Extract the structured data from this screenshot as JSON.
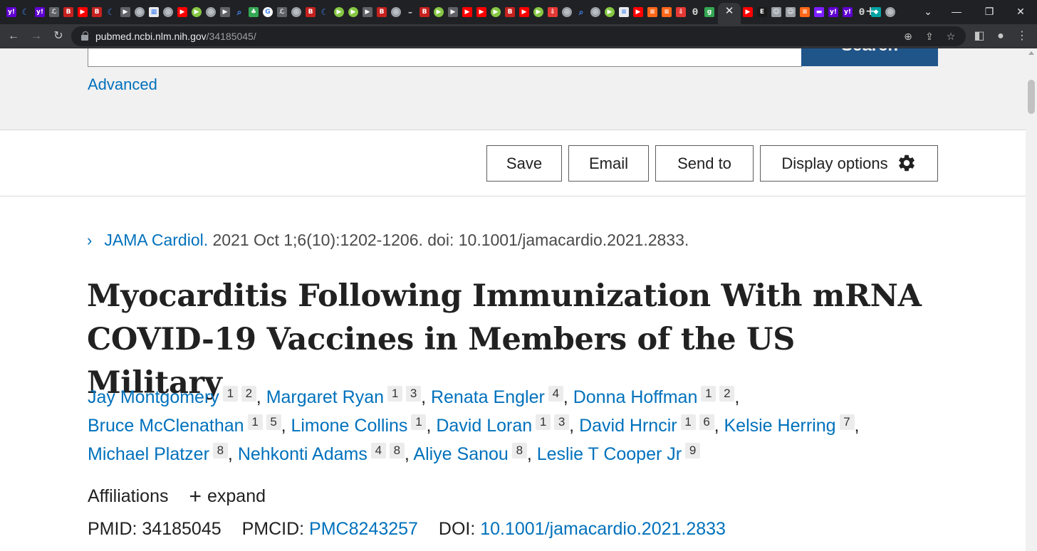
{
  "browser": {
    "favicons": [
      {
        "icon": "yahoo-icon",
        "bg": "#6001d2",
        "t": "y!"
      },
      {
        "icon": "crescent-icon",
        "bg": "#4285f4",
        "t": "☾",
        "shape": "n"
      },
      {
        "icon": "yahoo-icon",
        "bg": "#6001d2",
        "t": "y!"
      },
      {
        "icon": "text-icon",
        "bg": "#5f6368",
        "t": "ℒ"
      },
      {
        "icon": "bi-icon",
        "bg": "#c5221f",
        "t": "B"
      },
      {
        "icon": "youtube-icon",
        "bg": "#ff0000",
        "t": "▶"
      },
      {
        "icon": "bi-icon",
        "bg": "#c5221f",
        "t": "B"
      },
      {
        "icon": "crescent-icon",
        "bg": "#4285f4",
        "t": "☾",
        "shape": "n"
      },
      {
        "icon": "play-icon",
        "bg": "#5f6368",
        "t": "▶"
      },
      {
        "icon": "globe-icon",
        "bg": "#9aa0a6",
        "t": "◎",
        "shape": "c"
      },
      {
        "icon": "image-icon",
        "bg": "#e8eaed",
        "t": "▦"
      },
      {
        "icon": "globe-icon",
        "bg": "#9aa0a6",
        "t": "◎",
        "shape": "c"
      },
      {
        "icon": "youtube-icon",
        "bg": "#ff0000",
        "t": "▶"
      },
      {
        "icon": "rumble-icon",
        "bg": "#85c742",
        "t": "▶",
        "shape": "c"
      },
      {
        "icon": "globe-icon",
        "bg": "#9aa0a6",
        "t": "◎",
        "shape": "c"
      },
      {
        "icon": "play-icon",
        "bg": "#5f6368",
        "t": "▶"
      },
      {
        "icon": "search-icon",
        "bg": "#4285f4",
        "t": "⌕",
        "shape": "n"
      },
      {
        "icon": "tree-icon",
        "bg": "#34a853",
        "t": "♣"
      },
      {
        "icon": "google-icon",
        "bg": "#ffffff",
        "t": "G",
        "shape": "c"
      },
      {
        "icon": "text-icon",
        "bg": "#5f6368",
        "t": "ℒ"
      },
      {
        "icon": "globe-icon",
        "bg": "#9aa0a6",
        "t": "◎",
        "shape": "c"
      },
      {
        "icon": "bi-icon",
        "bg": "#c5221f",
        "t": "B"
      },
      {
        "icon": "crescent-icon",
        "bg": "#4285f4",
        "t": "☾",
        "shape": "n"
      },
      {
        "icon": "rumble-icon",
        "bg": "#85c742",
        "t": "▶",
        "shape": "c"
      },
      {
        "icon": "rumble-icon",
        "bg": "#85c742",
        "t": "▶",
        "shape": "c"
      },
      {
        "icon": "play-icon",
        "bg": "#5f6368",
        "t": "▶"
      },
      {
        "icon": "bi-icon",
        "bg": "#c5221f",
        "t": "B"
      },
      {
        "icon": "globe-icon",
        "bg": "#9aa0a6",
        "t": "◎",
        "shape": "c"
      },
      {
        "icon": "dash-icon",
        "bg": "#202124",
        "t": "–",
        "shape": "n"
      },
      {
        "icon": "bi-icon",
        "bg": "#c5221f",
        "t": "B"
      },
      {
        "icon": "rumble-icon",
        "bg": "#85c742",
        "t": "▶",
        "shape": "c"
      },
      {
        "icon": "play-icon",
        "bg": "#5f6368",
        "t": "▶"
      },
      {
        "icon": "youtube-icon",
        "bg": "#ff0000",
        "t": "▶"
      },
      {
        "icon": "youtube-icon",
        "bg": "#ff0000",
        "t": "▶"
      },
      {
        "icon": "rumble-icon",
        "bg": "#85c742",
        "t": "▶",
        "shape": "c"
      },
      {
        "icon": "bi-icon",
        "bg": "#c5221f",
        "t": "B"
      },
      {
        "icon": "youtube-icon",
        "bg": "#ff0000",
        "t": "▶"
      },
      {
        "icon": "rumble-icon",
        "bg": "#85c742",
        "t": "▶",
        "shape": "c"
      },
      {
        "icon": "download-icon",
        "bg": "#e53935",
        "t": "⇩"
      },
      {
        "icon": "globe-icon",
        "bg": "#9aa0a6",
        "t": "◎",
        "shape": "c"
      },
      {
        "icon": "search-icon",
        "bg": "#4285f4",
        "t": "⌕",
        "shape": "n"
      },
      {
        "icon": "globe-icon",
        "bg": "#9aa0a6",
        "t": "◎",
        "shape": "c"
      },
      {
        "icon": "rumble-icon",
        "bg": "#85c742",
        "t": "▶",
        "shape": "c"
      },
      {
        "icon": "news-icon",
        "bg": "#e8eaed",
        "t": "≡"
      },
      {
        "icon": "youtube-icon",
        "bg": "#ff0000",
        "t": "▶"
      },
      {
        "icon": "stack-icon",
        "bg": "#ff6719",
        "t": "≡"
      },
      {
        "icon": "stack-icon",
        "bg": "#ff6719",
        "t": "≡"
      },
      {
        "icon": "download-icon",
        "bg": "#e53935",
        "t": "⇩"
      },
      {
        "icon": "theta-icon",
        "bg": "#202124",
        "t": "θ",
        "shape": "n"
      },
      {
        "icon": "g-icon",
        "bg": "#34a853",
        "t": "g"
      },
      {
        "icon": "person-icon",
        "bg": "#9aa0a6",
        "t": "☺"
      },
      {
        "icon": "youtube-icon",
        "bg": "#ff0000",
        "t": "▶"
      },
      {
        "icon": "epoch-icon",
        "bg": "#1a1a1a",
        "t": "E"
      },
      {
        "icon": "person-icon",
        "bg": "#9aa0a6",
        "t": "☺"
      },
      {
        "icon": "person-icon",
        "bg": "#9aa0a6",
        "t": "☺"
      },
      {
        "icon": "stack-icon",
        "bg": "#ff6719",
        "t": "≡"
      },
      {
        "icon": "purple-icon",
        "bg": "#7e1fff",
        "t": "▬"
      },
      {
        "icon": "yahoo-icon",
        "bg": "#6001d2",
        "t": "y!"
      },
      {
        "icon": "yahoo-icon",
        "bg": "#6001d2",
        "t": "y!"
      },
      {
        "icon": "theta-icon",
        "bg": "#202124",
        "t": "θ",
        "shape": "n"
      },
      {
        "icon": "teal-icon",
        "bg": "#00a3a3",
        "t": "◆"
      },
      {
        "icon": "globe-icon",
        "bg": "#9aa0a6",
        "t": "◎",
        "shape": "c"
      }
    ],
    "url_host": "pubmed.ncbi.nlm.nih.gov",
    "url_path": "/34185045/"
  },
  "page": {
    "advanced_label": "Advanced",
    "search_button_label": "Search",
    "actions": {
      "save": "Save",
      "email": "Email",
      "send_to": "Send to",
      "display_options": "Display options"
    },
    "citation": {
      "journal": "JAMA Cardiol.",
      "details": "2021 Oct 1;6(10):1202-1206. doi: 10.1001/jamacardio.2021.2833."
    },
    "title_line1": "Myocarditis Following Immunization With mRNA",
    "title_line2": "COVID-19 Vaccines in Members of the US Military",
    "authors": [
      {
        "name": "Jay Montgomery",
        "affs": [
          "1",
          "2"
        ]
      },
      {
        "name": "Margaret Ryan",
        "affs": [
          "1",
          "3"
        ]
      },
      {
        "name": "Renata Engler",
        "affs": [
          "4"
        ]
      },
      {
        "name": "Donna Hoffman",
        "affs": [
          "1",
          "2"
        ]
      },
      {
        "name": "Bruce McClenathan",
        "affs": [
          "1",
          "5"
        ]
      },
      {
        "name": "Limone Collins",
        "affs": [
          "1"
        ]
      },
      {
        "name": "David Loran",
        "affs": [
          "1",
          "3"
        ]
      },
      {
        "name": "David Hrncir",
        "affs": [
          "1",
          "6"
        ]
      },
      {
        "name": "Kelsie Herring",
        "affs": [
          "7"
        ]
      },
      {
        "name": "Michael Platzer",
        "affs": [
          "8"
        ]
      },
      {
        "name": "Nehkonti Adams",
        "affs": [
          "4",
          "8"
        ]
      },
      {
        "name": "Aliye Sanou",
        "affs": [
          "8"
        ]
      },
      {
        "name": "Leslie T Cooper Jr",
        "affs": [
          "9"
        ]
      }
    ],
    "affiliations_label": "Affiliations",
    "expand_label": "expand",
    "ids": {
      "pmid_label": "PMID:",
      "pmid": "34185045",
      "pmcid_label": "PMCID:",
      "pmcid": "PMC8243257",
      "doi_label": "DOI:",
      "doi": "10.1001/jamacardio.2021.2833"
    }
  }
}
